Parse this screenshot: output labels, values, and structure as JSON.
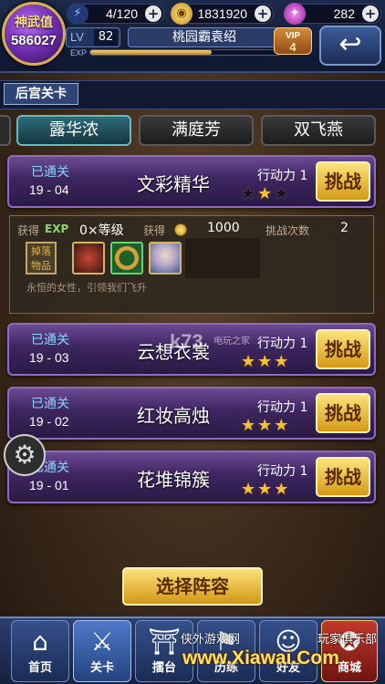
{
  "player": {
    "avatar_line1": "神武值",
    "avatar_line2": "586027",
    "level_label": "LV",
    "level": "82",
    "exp_label": "EXP",
    "exp_progress": 0.64,
    "name": "桃园霸袁绍",
    "vip": "VIP",
    "vip_level": "4"
  },
  "resources": [
    {
      "icon": "energy-icon",
      "value": "4/120"
    },
    {
      "icon": "coin-icon",
      "value": "1831920"
    },
    {
      "icon": "gem-icon",
      "value": "282"
    }
  ],
  "section_title": "后宫关卡",
  "tabs": [
    "露华浓",
    "满庭芳",
    "双飞燕"
  ],
  "stages": [
    {
      "status": "已通关",
      "number": "19 - 04",
      "name": "文彩精华",
      "energy": "行动力 1",
      "stars": [
        false,
        true,
        false
      ],
      "button": "挑战"
    },
    {
      "status": "已通关",
      "number": "19 - 03",
      "name": "云想衣裳",
      "energy": "行动力 1",
      "stars": [
        true,
        true,
        true
      ],
      "button": "挑战"
    },
    {
      "status": "已通关",
      "number": "19 - 02",
      "name": "红妆高烛",
      "energy": "行动力 1",
      "stars": [
        true,
        true,
        true
      ],
      "button": "挑战"
    },
    {
      "status": "已通关",
      "number": "19 - 01",
      "name": "花堆锦簇",
      "energy": "行动力 1",
      "stars": [
        true,
        true,
        true
      ],
      "button": "挑战"
    }
  ],
  "detail": {
    "exp_label": "获得",
    "exp_tag": "EXP",
    "exp_value": "0×等级",
    "coin_label": "获得",
    "coin_value": "1000",
    "attempts_label": "挑战次数",
    "attempts_value": "2",
    "drop_label": "掉落物品",
    "description": "永恒的女性，引领我们飞升"
  },
  "select_lineup": "选择阵容",
  "nav": [
    {
      "label": "首页",
      "icon": "home-icon"
    },
    {
      "label": "关卡",
      "icon": "swords-icon"
    },
    {
      "label": "擂台",
      "icon": "arena-icon"
    },
    {
      "label": "历练",
      "icon": "training-icon"
    },
    {
      "label": "好友",
      "icon": "friends-icon"
    },
    {
      "label": "商城",
      "icon": "shop-icon"
    }
  ],
  "watermarks": {
    "center": "k73",
    "center_sub": "电玩之家",
    "bottom_left": "侠外游戏网",
    "bottom_right": "玩家俱乐部",
    "bottom_url": "www.Xiawai.Com"
  }
}
